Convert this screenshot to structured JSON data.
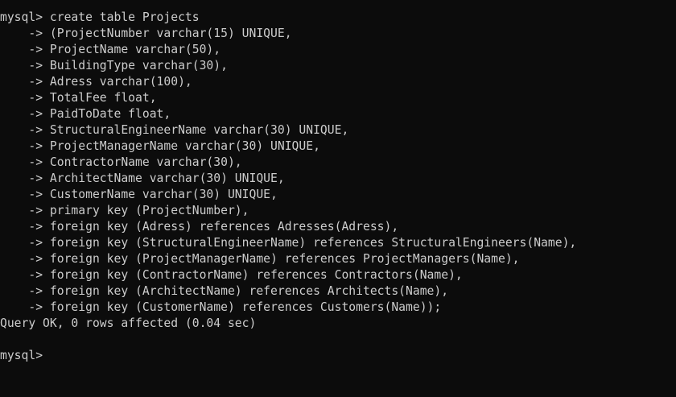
{
  "terminal": {
    "lines": [
      "mysql> create table Projects",
      "    -> (ProjectNumber varchar(15) UNIQUE,",
      "    -> ProjectName varchar(50),",
      "    -> BuildingType varchar(30),",
      "    -> Adress varchar(100),",
      "    -> TotalFee float,",
      "    -> PaidToDate float,",
      "    -> StructuralEngineerName varchar(30) UNIQUE,",
      "    -> ProjectManagerName varchar(30) UNIQUE,",
      "    -> ContractorName varchar(30),",
      "    -> ArchitectName varchar(30) UNIQUE,",
      "    -> CustomerName varchar(30) UNIQUE,",
      "    -> primary key (ProjectNumber),",
      "    -> foreign key (Adress) references Adresses(Adress),",
      "    -> foreign key (StructuralEngineerName) references StructuralEngineers(Name),",
      "    -> foreign key (ProjectManagerName) references ProjectManagers(Name),",
      "    -> foreign key (ContractorName) references Contractors(Name),",
      "    -> foreign key (ArchitectName) references Architects(Name),",
      "    -> foreign key (CustomerName) references Customers(Name));",
      "Query OK, 0 rows affected (0.04 sec)",
      "",
      "mysql>"
    ]
  }
}
